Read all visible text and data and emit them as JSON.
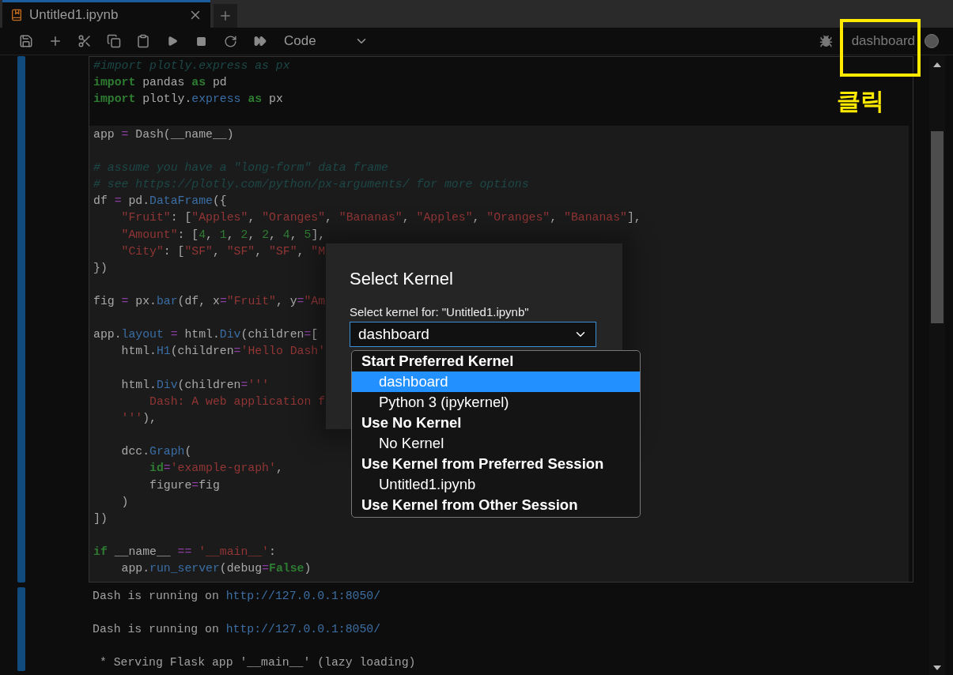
{
  "tab": {
    "title": "Untitled1.ipynb",
    "selected": true
  },
  "toolbar": {
    "cell_type": "Code",
    "kernel_name": "dashboard"
  },
  "annotation": {
    "label": "클릭"
  },
  "cell_sections": [
    {
      "blocks": [
        [
          {
            "tokens": [
              {
                "kind": "comment",
                "text": "#import plotly.express as px"
              }
            ]
          },
          {
            "tokens": [
              {
                "kind": "keyword",
                "text": "import"
              },
              {
                "kind": "plain",
                "text": " pandas "
              },
              {
                "kind": "keyword",
                "text": "as"
              },
              {
                "kind": "plain",
                "text": " pd"
              }
            ]
          },
          {
            "tokens": [
              {
                "kind": "keyword",
                "text": "import"
              },
              {
                "kind": "plain",
                "text": " plotly."
              },
              {
                "kind": "name",
                "text": "express"
              },
              {
                "kind": "keyword",
                "text": " as"
              },
              {
                "kind": "plain",
                "text": " px"
              }
            ]
          }
        ]
      ]
    },
    {
      "blocks": [
        [
          {
            "tokens": [
              {
                "kind": "plain",
                "text": "app "
              },
              {
                "kind": "operator",
                "text": "="
              },
              {
                "kind": "plain",
                "text": " Dash(__name__)"
              }
            ]
          }
        ],
        [
          {
            "tokens": [
              {
                "kind": "comment",
                "text": "# assume you have a \"long-form\" data frame"
              }
            ]
          },
          {
            "tokens": [
              {
                "kind": "comment",
                "text": "# see https://plotly.com/python/px-arguments/ for more options"
              }
            ]
          },
          {
            "tokens": [
              {
                "kind": "plain",
                "text": "df "
              },
              {
                "kind": "operator",
                "text": "="
              },
              {
                "kind": "plain",
                "text": " pd."
              },
              {
                "kind": "name",
                "text": "DataFrame"
              },
              {
                "kind": "plain",
                "text": "({"
              }
            ]
          },
          {
            "tokens": [
              {
                "kind": "string",
                "text": "    \"Fruit\""
              },
              {
                "kind": "plain",
                "text": ": ["
              },
              {
                "kind": "string",
                "text": "\"Apples\""
              },
              {
                "kind": "plain",
                "text": ", "
              },
              {
                "kind": "string",
                "text": "\"Oranges\""
              },
              {
                "kind": "plain",
                "text": ", "
              },
              {
                "kind": "string",
                "text": "\"Bananas\""
              },
              {
                "kind": "plain",
                "text": ", "
              },
              {
                "kind": "string",
                "text": "\"Apples\""
              },
              {
                "kind": "plain",
                "text": ", "
              },
              {
                "kind": "string",
                "text": "\"Oranges\""
              },
              {
                "kind": "plain",
                "text": ", "
              },
              {
                "kind": "string",
                "text": "\"Bananas\""
              },
              {
                "kind": "plain",
                "text": "],"
              }
            ]
          },
          {
            "tokens": [
              {
                "kind": "string",
                "text": "    \"Amount\""
              },
              {
                "kind": "plain",
                "text": ": ["
              },
              {
                "kind": "number",
                "text": "4"
              },
              {
                "kind": "plain",
                "text": ", "
              },
              {
                "kind": "number",
                "text": "1"
              },
              {
                "kind": "plain",
                "text": ", "
              },
              {
                "kind": "number",
                "text": "2"
              },
              {
                "kind": "plain",
                "text": ", "
              },
              {
                "kind": "number",
                "text": "2"
              },
              {
                "kind": "plain",
                "text": ", "
              },
              {
                "kind": "number",
                "text": "4"
              },
              {
                "kind": "plain",
                "text": ", "
              },
              {
                "kind": "number",
                "text": "5"
              },
              {
                "kind": "plain",
                "text": "],"
              }
            ]
          },
          {
            "tokens": [
              {
                "kind": "string",
                "text": "    \"City\""
              },
              {
                "kind": "plain",
                "text": ": ["
              },
              {
                "kind": "string",
                "text": "\"SF\""
              },
              {
                "kind": "plain",
                "text": ", "
              },
              {
                "kind": "string",
                "text": "\"SF\""
              },
              {
                "kind": "plain",
                "text": ", "
              },
              {
                "kind": "string",
                "text": "\"SF\""
              },
              {
                "kind": "plain",
                "text": ", "
              },
              {
                "kind": "string",
                "text": "\"M"
              }
            ]
          },
          {
            "tokens": [
              {
                "kind": "plain",
                "text": "})"
              }
            ]
          }
        ],
        [
          {
            "tokens": [
              {
                "kind": "plain",
                "text": "fig "
              },
              {
                "kind": "operator",
                "text": "="
              },
              {
                "kind": "plain",
                "text": " px."
              },
              {
                "kind": "name",
                "text": "bar"
              },
              {
                "kind": "plain",
                "text": "(df, x"
              },
              {
                "kind": "operator",
                "text": "="
              },
              {
                "kind": "string",
                "text": "\"Fruit\""
              },
              {
                "kind": "plain",
                "text": ", y"
              },
              {
                "kind": "operator",
                "text": "="
              },
              {
                "kind": "string",
                "text": "\"Am"
              }
            ]
          }
        ],
        [
          {
            "tokens": [
              {
                "kind": "plain",
                "text": "app."
              },
              {
                "kind": "name",
                "text": "layout"
              },
              {
                "kind": "operator",
                "text": " ="
              },
              {
                "kind": "plain",
                "text": " html."
              },
              {
                "kind": "name",
                "text": "Div"
              },
              {
                "kind": "plain",
                "text": "(children"
              },
              {
                "kind": "operator",
                "text": "="
              },
              {
                "kind": "plain",
                "text": "["
              }
            ]
          },
          {
            "tokens": [
              {
                "kind": "plain",
                "text": "    html."
              },
              {
                "kind": "name",
                "text": "H1"
              },
              {
                "kind": "plain",
                "text": "(children"
              },
              {
                "kind": "operator",
                "text": "="
              },
              {
                "kind": "string",
                "text": "'Hello Dash'"
              }
            ]
          }
        ],
        [
          {
            "tokens": [
              {
                "kind": "plain",
                "text": "    html."
              },
              {
                "kind": "name",
                "text": "Div"
              },
              {
                "kind": "plain",
                "text": "(children"
              },
              {
                "kind": "operator",
                "text": "="
              },
              {
                "kind": "string",
                "text": "'''"
              }
            ]
          },
          {
            "tokens": [
              {
                "kind": "string",
                "text": "        Dash: A web application f"
              }
            ]
          },
          {
            "tokens": [
              {
                "kind": "string",
                "text": "    '''"
              },
              {
                "kind": "plain",
                "text": "),"
              }
            ]
          }
        ],
        [
          {
            "tokens": [
              {
                "kind": "plain",
                "text": "    dcc."
              },
              {
                "kind": "name",
                "text": "Graph"
              },
              {
                "kind": "plain",
                "text": "("
              }
            ]
          },
          {
            "tokens": [
              {
                "kind": "keyword",
                "text": "        id"
              },
              {
                "kind": "operator",
                "text": "="
              },
              {
                "kind": "string",
                "text": "'example-graph'"
              },
              {
                "kind": "plain",
                "text": ","
              }
            ]
          },
          {
            "tokens": [
              {
                "kind": "plain",
                "text": "        figure"
              },
              {
                "kind": "operator",
                "text": "="
              },
              {
                "kind": "plain",
                "text": "fig"
              }
            ]
          },
          {
            "tokens": [
              {
                "kind": "plain",
                "text": "    )"
              }
            ]
          },
          {
            "tokens": [
              {
                "kind": "plain",
                "text": "])"
              }
            ]
          }
        ],
        [
          {
            "tokens": [
              {
                "kind": "keyword",
                "text": "if"
              },
              {
                "kind": "plain",
                "text": " __name__ "
              },
              {
                "kind": "operator",
                "text": "=="
              },
              {
                "kind": "string",
                "text": " '__main__'"
              },
              {
                "kind": "plain",
                "text": ":"
              }
            ]
          },
          {
            "tokens": [
              {
                "kind": "plain",
                "text": "    app."
              },
              {
                "kind": "name",
                "text": "run_server"
              },
              {
                "kind": "plain",
                "text": "(debug"
              },
              {
                "kind": "operator",
                "text": "="
              },
              {
                "kind": "keyword",
                "text": "False"
              },
              {
                "kind": "plain",
                "text": ")"
              }
            ]
          }
        ]
      ]
    }
  ],
  "output_lines": [
    {
      "text": "Dash is running on ",
      "link": "http://127.0.0.1:8050/"
    },
    {
      "text": "Dash is running on ",
      "link": "http://127.0.0.1:8050/"
    },
    {
      "text": " * Serving Flask app '__main__' (lazy loading)"
    }
  ],
  "dialog": {
    "title": "Select Kernel",
    "label": "Select kernel for: \"Untitled1.ipynb\"",
    "value": "dashboard",
    "options": [
      {
        "kind": "group",
        "text": "Start Preferred Kernel"
      },
      {
        "kind": "option",
        "text": "dashboard",
        "selected": true
      },
      {
        "kind": "option",
        "text": "Python 3 (ipykernel)",
        "selected": false
      },
      {
        "kind": "group",
        "text": "Use No Kernel"
      },
      {
        "kind": "option",
        "text": "No Kernel",
        "selected": false
      },
      {
        "kind": "group",
        "text": "Use Kernel from Preferred Session"
      },
      {
        "kind": "option",
        "text": "Untitled1.ipynb",
        "selected": false
      },
      {
        "kind": "group",
        "text": "Use Kernel from Other Session"
      }
    ]
  }
}
